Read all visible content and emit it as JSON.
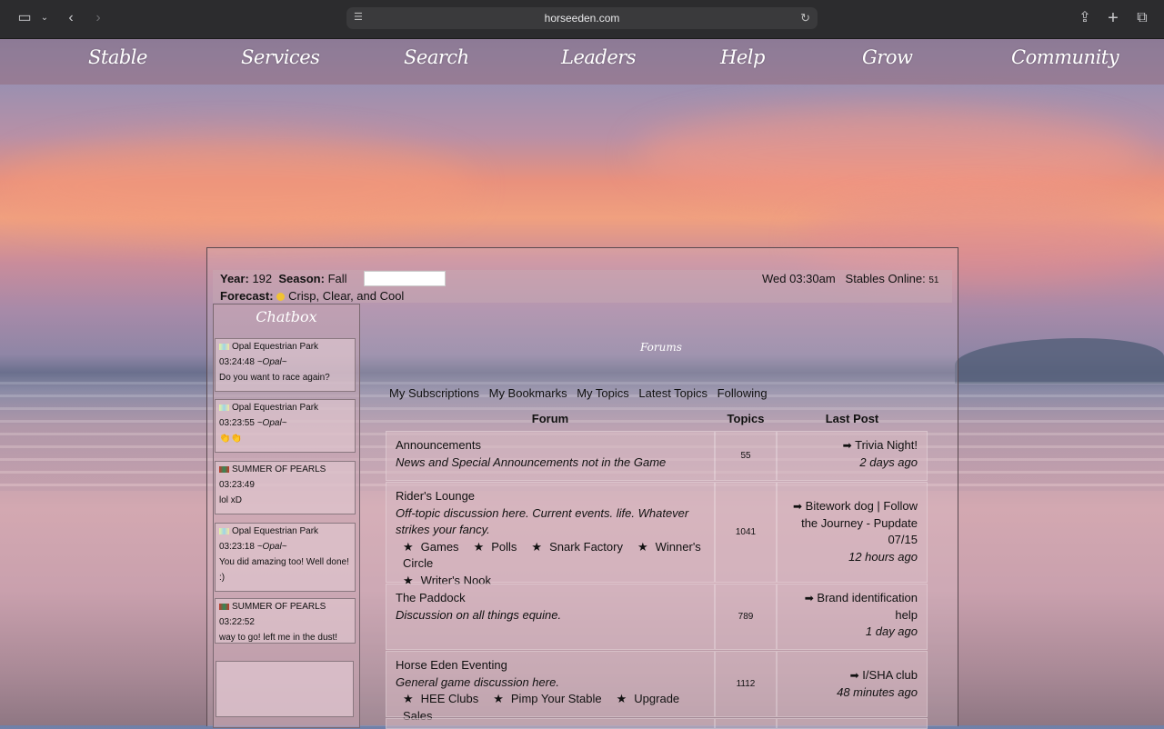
{
  "browser": {
    "url": "horseeden.com"
  },
  "nav": {
    "items": [
      "Stable",
      "Services",
      "Search",
      "Leaders",
      "Help",
      "Grow",
      "Community"
    ]
  },
  "info": {
    "year_label": "Year:",
    "year": "192",
    "season_label": "Season:",
    "season": "Fall",
    "forecast_label": "Forecast:",
    "forecast": "Crisp, Clear, and Cool",
    "time": "Wed 03:30am",
    "stables_online_label": "Stables Online:",
    "stables_online": "51"
  },
  "chatbox": {
    "title": "Chatbox",
    "messages": [
      {
        "user": "Opal Equestrian Park",
        "time": "03:24:48",
        "nick": "~Opal~",
        "text": "Do you want to race again?"
      },
      {
        "user": "Opal Equestrian Park",
        "time": "03:23:55",
        "nick": "~Opal~",
        "text": "👏👏"
      },
      {
        "user": "SUMMER OF PEARLS",
        "time": "03:23:49",
        "nick": "",
        "text": "lol xD"
      },
      {
        "user": "Opal Equestrian Park",
        "time": "03:23:18",
        "nick": "~Opal~",
        "text": "You did amazing too! Well done! :)"
      },
      {
        "user": "SUMMER OF PEARLS",
        "time": "03:22:52",
        "nick": "",
        "text": "way to go! left me in the dust!"
      }
    ]
  },
  "forums": {
    "title": "Forums",
    "links": [
      "My Subscriptions",
      "My Bookmarks",
      "My Topics",
      "Latest Topics",
      "Following"
    ],
    "columns": [
      "Forum",
      "Topics",
      "Last Post"
    ],
    "rows": [
      {
        "name": "Announcements",
        "desc": "News and Special Announcements not in the Game",
        "subs": [],
        "topics": "55",
        "last_title": "Trivia Night!",
        "last_time": "2 days ago"
      },
      {
        "name": "Rider's Lounge",
        "desc": "Off-topic discussion here. Current events. life. Whatever strikes your fancy.",
        "subs": [
          "Games",
          "Polls",
          "Snark Factory",
          "Winner's Circle",
          "Writer's Nook"
        ],
        "topics": "1041",
        "last_title": "Bitework dog | Follow the Journey - Pupdate 07/15",
        "last_time": "12 hours ago"
      },
      {
        "name": "The Paddock",
        "desc": "Discussion on all things equine.",
        "subs": [],
        "topics": "789",
        "last_title": "Brand identification help",
        "last_time": "1 day ago"
      },
      {
        "name": "Horse Eden Eventing",
        "desc": "General game discussion here.",
        "subs": [
          "HEE Clubs",
          "Pimp Your Stable",
          "Upgrade Sales"
        ],
        "topics": "1112",
        "last_title": "I/SHA club",
        "last_time": "48 minutes ago"
      }
    ]
  }
}
